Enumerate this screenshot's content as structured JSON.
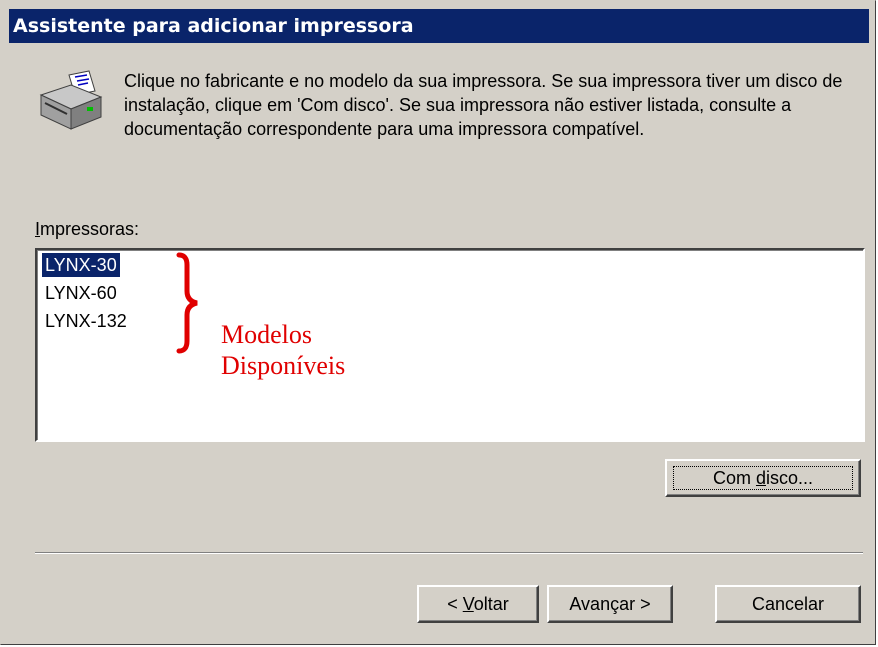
{
  "window": {
    "title": "Assistente para adicionar impressora"
  },
  "intro": {
    "icon": "printer-icon",
    "text": "Clique no fabricante e no modelo da sua impressora. Se sua impressora tiver um disco de instalação, clique em 'Com disco'. Se sua impressora não estiver listada, consulte a documentação correspondente para uma impressora compatível."
  },
  "printers": {
    "label_accel": "I",
    "label_rest": "mpressoras:",
    "items": [
      "LYNX-30",
      "LYNX-60",
      "LYNX-132"
    ],
    "selected": "LYNX-30"
  },
  "annotation": {
    "line1": "Modelos",
    "line2": "Disponíveis",
    "color": "#e00000"
  },
  "buttons": {
    "have_disk_pre": "Com ",
    "have_disk_accel": "d",
    "have_disk_post": "isco...",
    "back_pre": "< ",
    "back_accel": "V",
    "back_post": "oltar",
    "next": "Avançar >",
    "cancel": "Cancelar"
  },
  "colors": {
    "title_bar": "#0a246a",
    "dialog_face": "#d4d0c8",
    "selection": "#0a246a"
  }
}
